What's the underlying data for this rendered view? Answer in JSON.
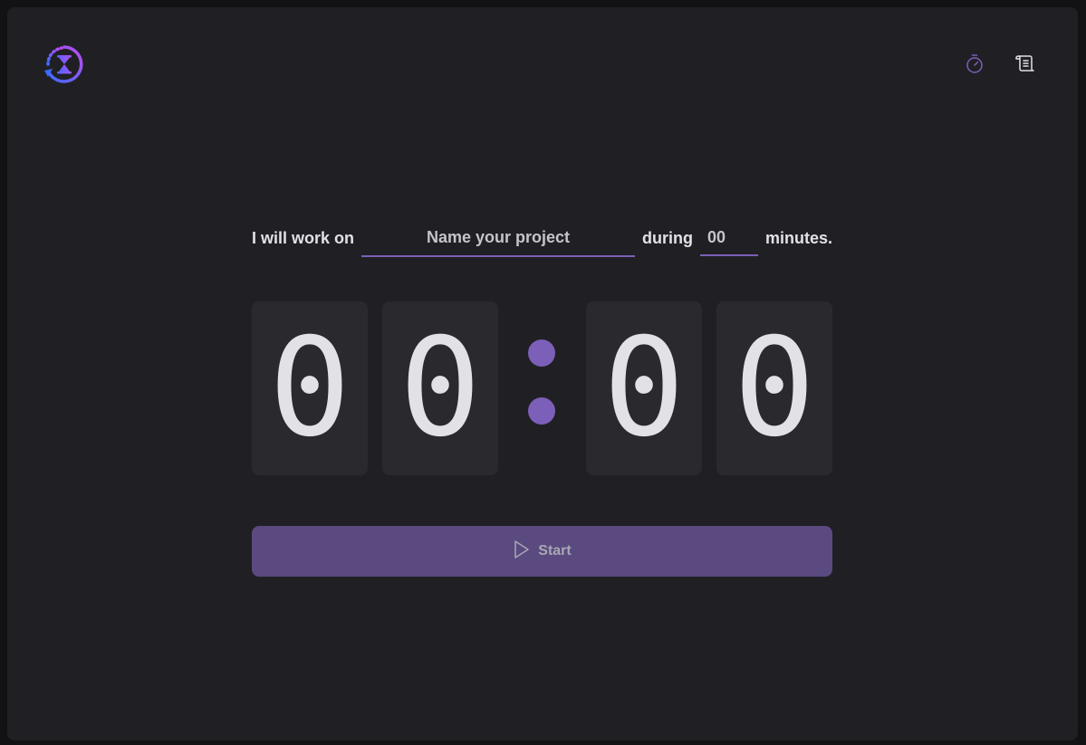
{
  "header": {
    "logo_icon": "hourglass-refresh-icon",
    "nav": [
      {
        "icon": "timer-icon",
        "color": "#7c5fb8"
      },
      {
        "icon": "scroll-history-icon",
        "color": "#e1e1e6"
      }
    ]
  },
  "form": {
    "prefix": "I will work on",
    "project_placeholder": "Name your project",
    "project_value": "",
    "during": "during",
    "minutes_placeholder": "00",
    "minutes_value": "",
    "suffix": "minutes."
  },
  "countdown": {
    "minutes_tens": "0",
    "minutes_ones": "0",
    "seconds_tens": "0",
    "seconds_ones": "0"
  },
  "start_button": {
    "label": "Start",
    "icon": "play-icon",
    "disabled": true
  },
  "colors": {
    "accent": "#7c5fb8",
    "button_disabled": "#5a4a80",
    "background": "#202024",
    "card": "#29292e",
    "text": "#e1e1e6"
  }
}
